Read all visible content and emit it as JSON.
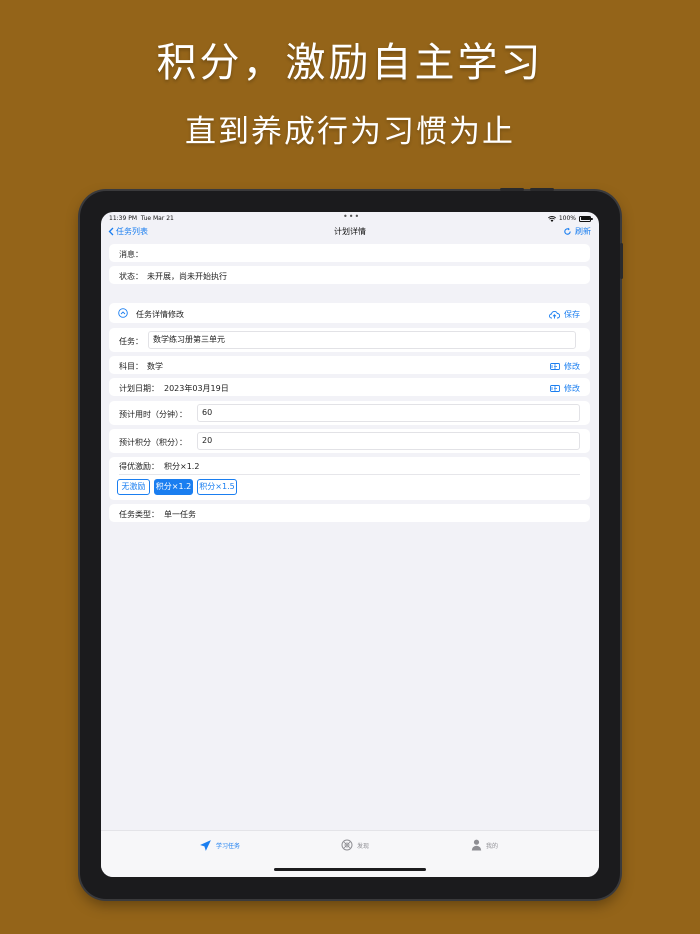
{
  "promo": {
    "headline": "积分，激励自主学习",
    "subheadline": "直到养成行为习惯为止"
  },
  "statusbar": {
    "time": "11:39 PM",
    "date": "Tue Mar 21",
    "battery": "100%"
  },
  "nav": {
    "back_label": "任务列表",
    "title": "计划详情",
    "refresh_label": "刷新"
  },
  "info": {
    "message_label": "消息：",
    "message_value": "",
    "status_label": "状态：",
    "status_value": "未开展，尚未开始执行"
  },
  "section": {
    "title": "任务详情修改",
    "save_label": "保存"
  },
  "task": {
    "label": "任务：",
    "value": "数学练习册第三单元"
  },
  "subject": {
    "label": "科目：",
    "value": "数学",
    "edit_label": "修改"
  },
  "plan_date": {
    "label": "计划日期：",
    "value": "2023年03月19日",
    "edit_label": "修改"
  },
  "duration": {
    "label": "预计用时（分钟）：",
    "value": "60"
  },
  "points": {
    "label": "预计积分（积分）：",
    "value": "20"
  },
  "incentive": {
    "label": "得优激励：",
    "value": "积分×1.2",
    "options": [
      "无激励",
      "积分×1.2",
      "积分×1.5"
    ],
    "selected_index": 1
  },
  "task_type": {
    "label": "任务类型：",
    "value": "单一任务"
  },
  "tabbar": {
    "tabs": [
      {
        "label": "学习任务",
        "icon": "paper-plane-icon",
        "active": true
      },
      {
        "label": "发现",
        "icon": "compass-icon",
        "active": false
      },
      {
        "label": "我的",
        "icon": "person-icon",
        "active": false
      }
    ]
  },
  "colors": {
    "background": "#946419",
    "accent": "#1a7ef0",
    "screen_bg": "#f2f2f7"
  }
}
